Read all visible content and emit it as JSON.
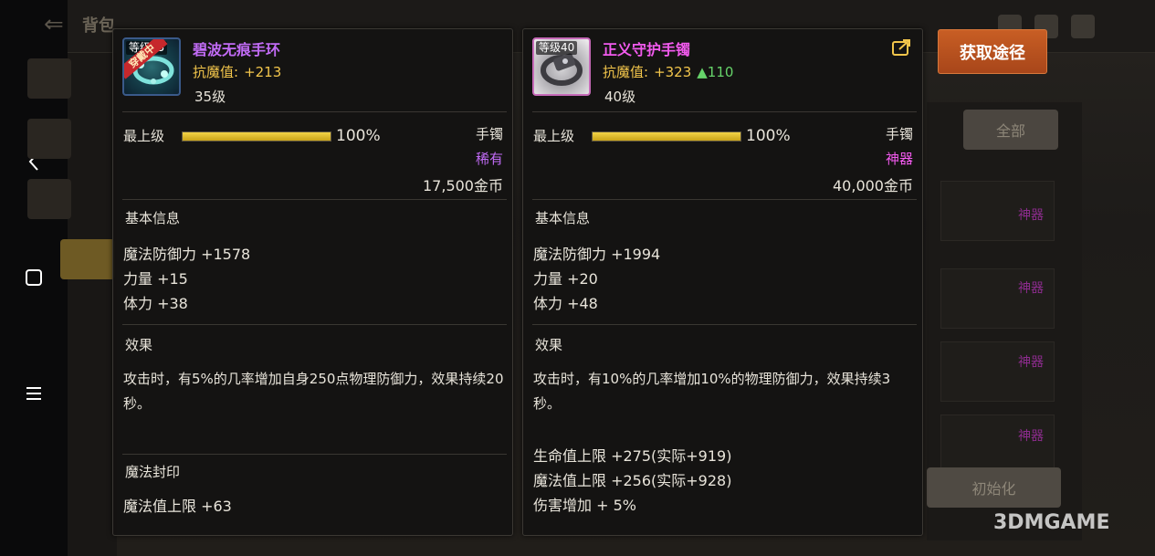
{
  "background": {
    "title": "背包",
    "all_button": "全部",
    "reset_button": "初始化",
    "rarity_markers": [
      "神器",
      "神器",
      "神器",
      "神器"
    ]
  },
  "source_button": {
    "label": "获取途径"
  },
  "left_item": {
    "level_tag": "等级35",
    "equipped_tag": "穿戴中",
    "name": "碧波无痕手环",
    "resist_label": "抗魔值:",
    "resist_value": "+213",
    "level": "35级",
    "max_level_label": "最上级",
    "progress": 100,
    "progress_text": "100%",
    "slot": "手镯",
    "rarity": "稀有",
    "price": "17,500金币",
    "basic_title": "基本信息",
    "stats": [
      "魔法防御力 +1578",
      "力量 +15",
      "体力 +38"
    ],
    "effect_title": "效果",
    "effect_text": "攻击时，有5%的几率增加自身250点物理防御力，效果持续20秒。",
    "seal_title": "魔法封印",
    "seal_stat": "魔法值上限 +63"
  },
  "right_item": {
    "level_tag": "等级40",
    "name": "正义守护手镯",
    "resist_label": "抗魔值:",
    "resist_value": "+323",
    "resist_up": "▲110",
    "level": "40级",
    "max_level_label": "最上级",
    "progress": 100,
    "progress_text": "100%",
    "slot": "手镯",
    "rarity": "神器",
    "price": "40,000金币",
    "basic_title": "基本信息",
    "stats": [
      "魔法防御力 +1994",
      "力量 +20",
      "体力 +48"
    ],
    "effect_title": "效果",
    "effect_text": "攻击时，有10%的几率增加10%的物理防御力，效果持续3秒。",
    "extra_stats": [
      "生命值上限 +275(实际+919)",
      "魔法值上限 +256(实际+928)",
      "伤害增加 + 5%"
    ]
  },
  "watermark": "3DMGAME",
  "colors": {
    "rare": "#c16bf5",
    "myth": "#f25aee",
    "gold": "#f2c54b",
    "up": "#66d36a",
    "source_button": "#c85e24"
  }
}
